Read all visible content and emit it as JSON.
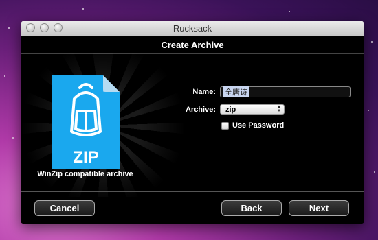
{
  "window": {
    "title": "Rucksack"
  },
  "dialog": {
    "header": "Create Archive",
    "archive_caption": "WinZip compatible archive",
    "icon_label": "ZIP"
  },
  "form": {
    "name_label": "Name:",
    "name_value": "全唐诗",
    "archive_label": "Archive:",
    "archive_selected": "zip",
    "use_password_label": "Use Password",
    "use_password_checked": false
  },
  "buttons": {
    "cancel": "Cancel",
    "back": "Back",
    "next": "Next"
  },
  "colors": {
    "zip_icon_blue": "#1aa8ee",
    "window_bg": "#000000"
  }
}
